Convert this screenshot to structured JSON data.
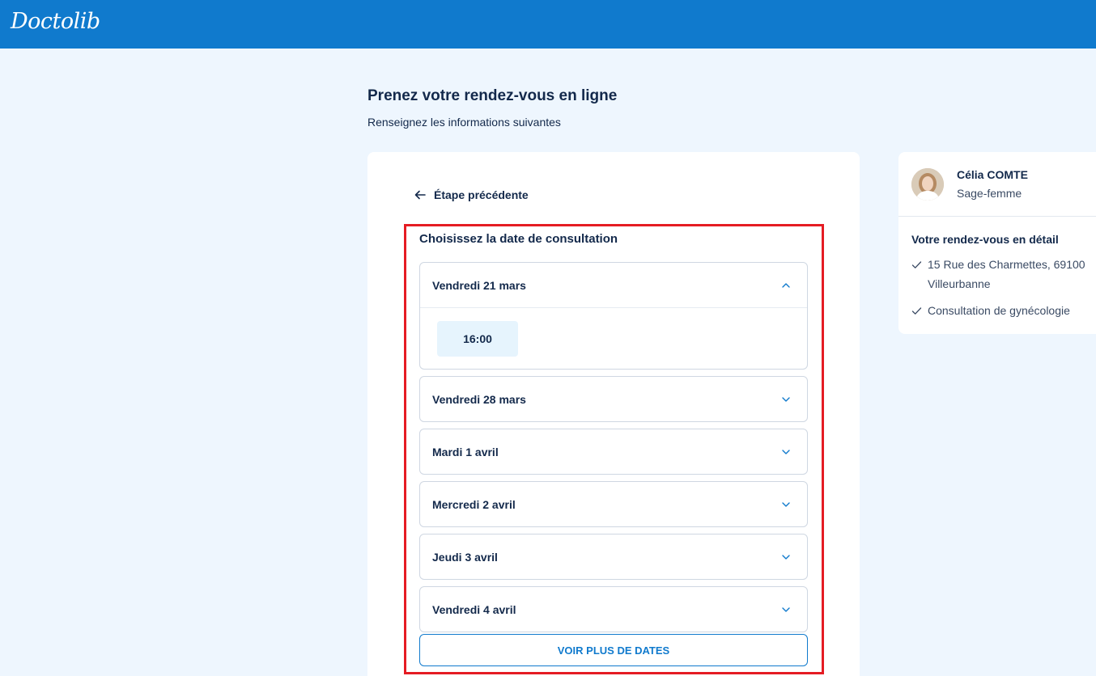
{
  "header": {
    "logo": "Doctolib",
    "brand_color": "#107acd"
  },
  "page": {
    "title": "Prenez votre rendez-vous en ligne",
    "subtitle": "Renseignez les informations suivantes"
  },
  "nav": {
    "back_label": "Étape précédente",
    "back_icon": "arrow-left-icon"
  },
  "booking": {
    "section_title": "Choisissez la date de consultation",
    "dates": [
      {
        "label": "Vendredi 21 mars",
        "expanded": true,
        "slots": [
          "16:00"
        ]
      },
      {
        "label": "Vendredi 28 mars",
        "expanded": false
      },
      {
        "label": "Mardi 1 avril",
        "expanded": false
      },
      {
        "label": "Mercredi 2 avril",
        "expanded": false
      },
      {
        "label": "Jeudi 3 avril",
        "expanded": false
      },
      {
        "label": "Vendredi 4 avril",
        "expanded": false
      }
    ],
    "more_label": "VOIR PLUS DE DATES",
    "highlight_color": "#e51c23"
  },
  "practitioner": {
    "name": "Célia COMTE",
    "role": "Sage-femme",
    "details_title": "Votre rendez-vous en détail",
    "details": [
      "15 Rue des Charmettes, 69100 Villeurbanne",
      "Consultation de gynécologie"
    ]
  }
}
